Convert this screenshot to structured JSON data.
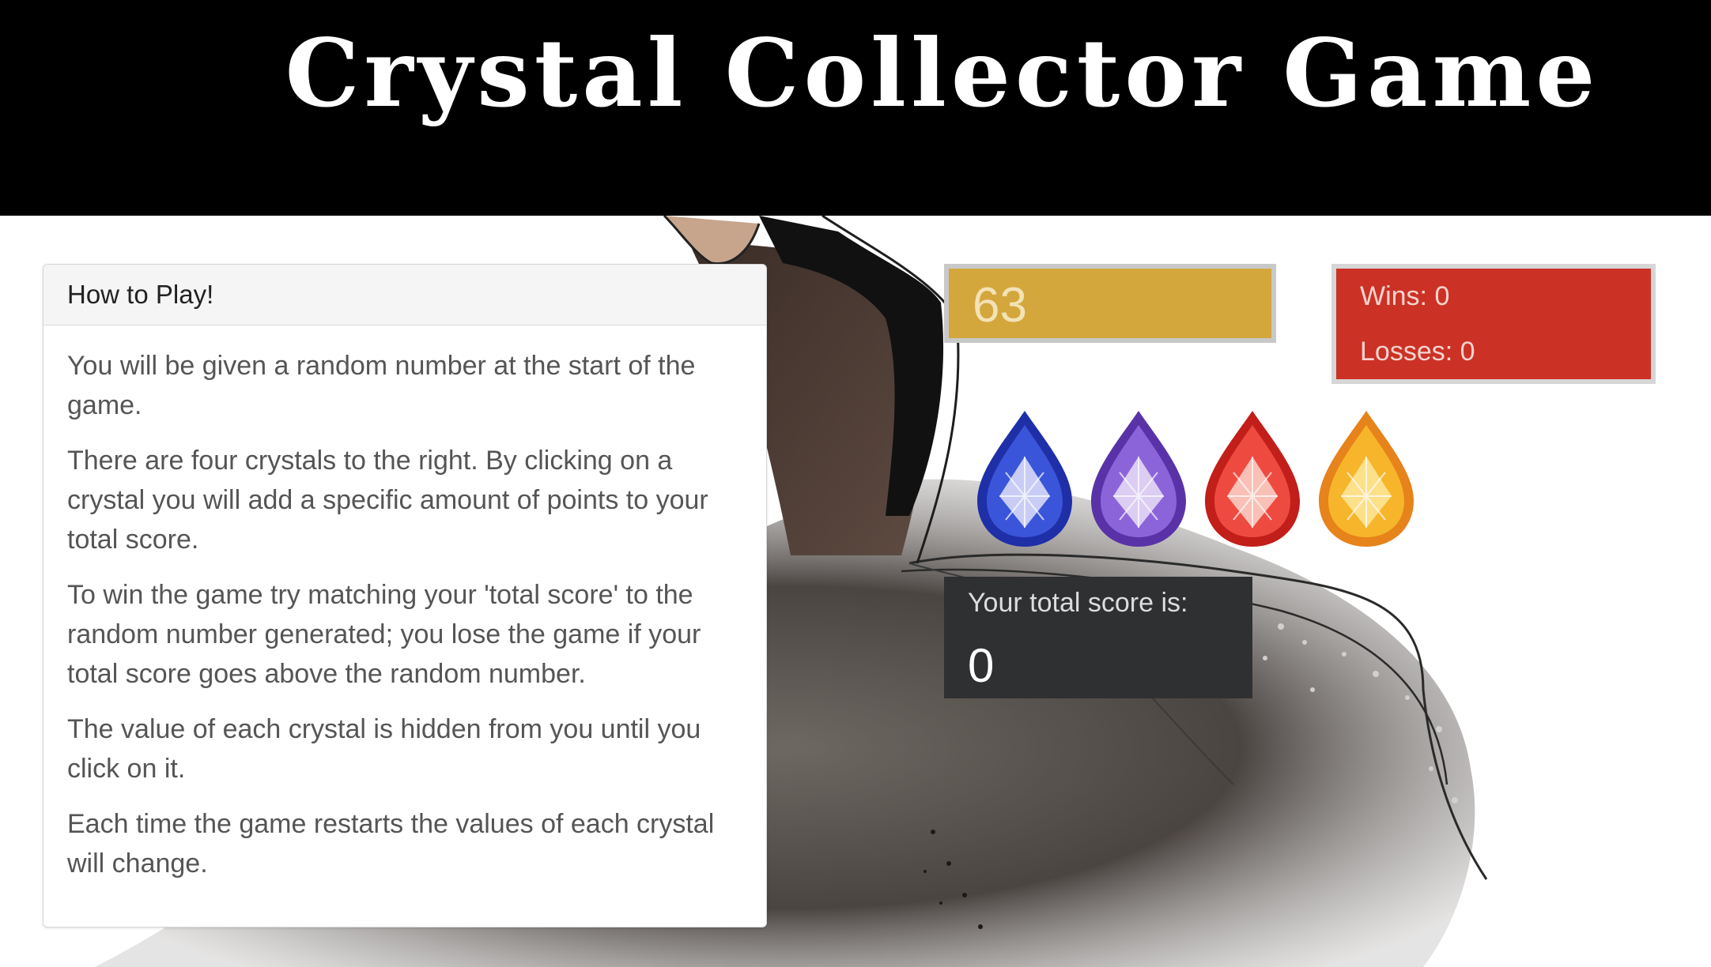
{
  "header": {
    "title": "Crystal Collector Game"
  },
  "instructions": {
    "heading": "How to Play!",
    "paragraphs": [
      "You will be given a random number at the start of the game.",
      "There are four crystals to the right. By clicking on a crystal you will add a specific amount of points to your total score.",
      "To win the game try matching your 'total score' to the random number generated; you lose the game if your total score goes above the random number.",
      "The value of each crystal is hidden from you until you click on it.",
      "Each time the game restarts the values of each crystal will change."
    ]
  },
  "target": {
    "value": "63",
    "color": "#d4a73d"
  },
  "scoreboard": {
    "wins_label": "Wins: 0",
    "losses_label": "Losses: 0",
    "color": "#cc3125"
  },
  "crystals": [
    {
      "name": "blue-crystal-icon",
      "color": "#2a3fc9"
    },
    {
      "name": "purple-crystal-icon",
      "color": "#7a4fc6"
    },
    {
      "name": "red-crystal-icon",
      "color": "#e2332b"
    },
    {
      "name": "orange-crystal-icon",
      "color": "#f1a51f"
    }
  ],
  "total": {
    "label": "Your total score is:",
    "value": "0"
  }
}
